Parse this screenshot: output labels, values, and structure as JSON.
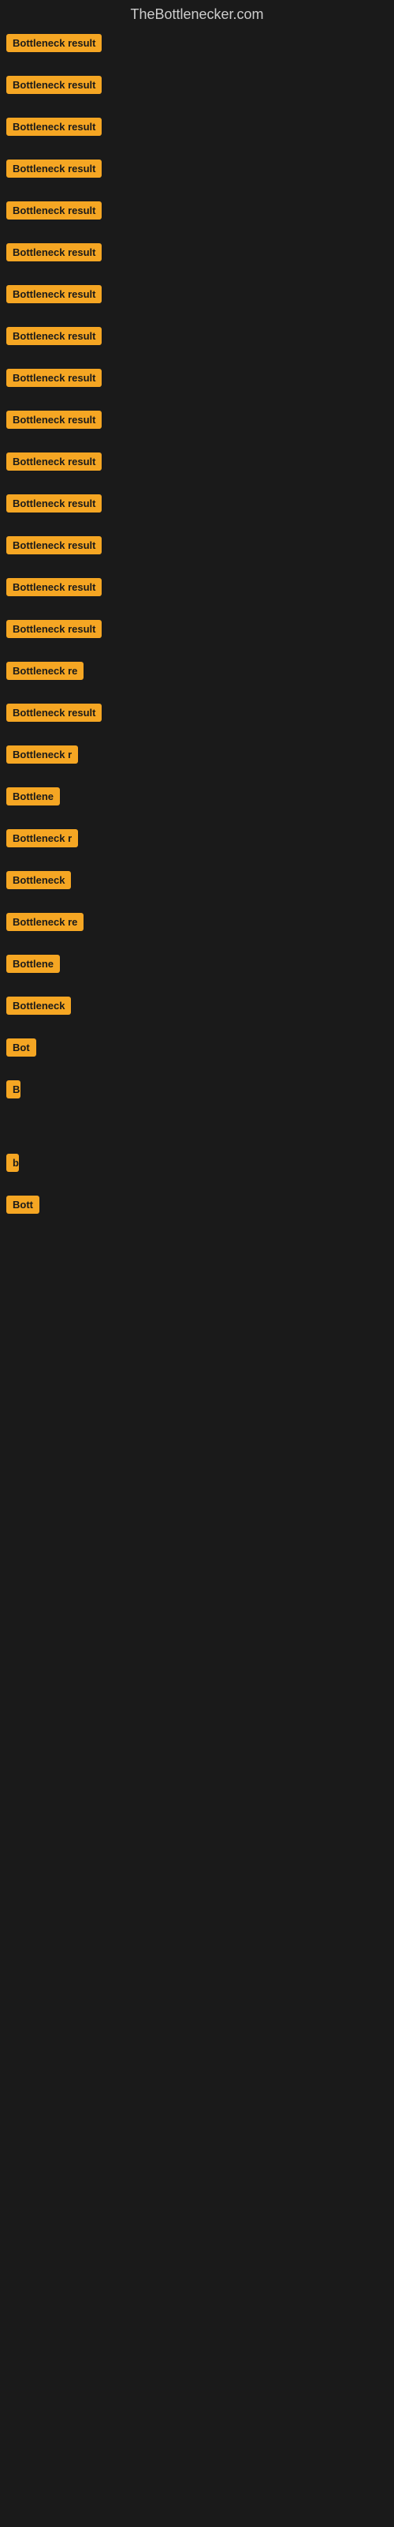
{
  "site": {
    "title": "TheBottlenecker.com"
  },
  "items": [
    {
      "label": "Bottleneck result",
      "width": 145
    },
    {
      "label": "Bottleneck result",
      "width": 145
    },
    {
      "label": "Bottleneck result",
      "width": 145
    },
    {
      "label": "Bottleneck result",
      "width": 145
    },
    {
      "label": "Bottleneck result",
      "width": 145
    },
    {
      "label": "Bottleneck result",
      "width": 145
    },
    {
      "label": "Bottleneck result",
      "width": 145
    },
    {
      "label": "Bottleneck result",
      "width": 145
    },
    {
      "label": "Bottleneck result",
      "width": 145
    },
    {
      "label": "Bottleneck result",
      "width": 145
    },
    {
      "label": "Bottleneck result",
      "width": 145
    },
    {
      "label": "Bottleneck result",
      "width": 145
    },
    {
      "label": "Bottleneck result",
      "width": 145
    },
    {
      "label": "Bottleneck result",
      "width": 145
    },
    {
      "label": "Bottleneck result",
      "width": 145
    },
    {
      "label": "Bottleneck re",
      "width": 110
    },
    {
      "label": "Bottleneck result",
      "width": 130
    },
    {
      "label": "Bottleneck r",
      "width": 100
    },
    {
      "label": "Bottlene",
      "width": 80
    },
    {
      "label": "Bottleneck r",
      "width": 100
    },
    {
      "label": "Bottleneck",
      "width": 90
    },
    {
      "label": "Bottleneck re",
      "width": 108
    },
    {
      "label": "Bottlene",
      "width": 78
    },
    {
      "label": "Bottleneck",
      "width": 88
    },
    {
      "label": "Bot",
      "width": 42
    },
    {
      "label": "B",
      "width": 18
    },
    {
      "label": "",
      "width": 0
    },
    {
      "label": "b",
      "width": 10
    },
    {
      "label": "Bott",
      "width": 44
    },
    {
      "label": "",
      "width": 0
    },
    {
      "label": "",
      "width": 0
    },
    {
      "label": "",
      "width": 0
    },
    {
      "label": "",
      "width": 0
    },
    {
      "label": "",
      "width": 0
    }
  ]
}
